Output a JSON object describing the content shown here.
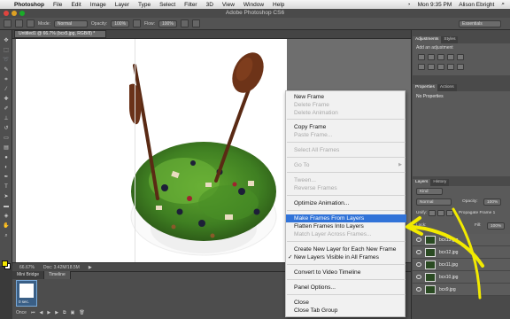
{
  "menubar": {
    "app": "Photoshop",
    "items": [
      "File",
      "Edit",
      "Image",
      "Layer",
      "Type",
      "Select",
      "Filter",
      "3D",
      "View",
      "Window",
      "Help"
    ],
    "clock": "Mon 9:35 PM",
    "user": "Alison Ebright"
  },
  "window": {
    "title": "Adobe Photoshop CS6"
  },
  "options": {
    "mode_label": "Mode:",
    "mode_value": "Normal",
    "opacity_label": "Opacity:",
    "opacity_value": "100%",
    "flow_label": "Flow:",
    "flow_value": "100%",
    "workspace": "Essentials"
  },
  "document": {
    "tab_label": "Untitled1 @ 66.7% (bcx5.jpg, RGB/8) *",
    "zoom": "66.67%",
    "doc_info": "Doc: 3.42M/18.5M"
  },
  "timeline": {
    "tabs": [
      "Mini Bridge",
      "Timeline"
    ],
    "frame_label": "0 sec.",
    "loop": "Once"
  },
  "panels": {
    "adjustments_tabs": [
      "Adjustments",
      "Styles"
    ],
    "adjustments_hint": "Add an adjustment",
    "properties_tabs": [
      "Properties",
      "Actions"
    ],
    "properties_body": "No Properties",
    "layers_tabs": [
      "Layers",
      "History"
    ],
    "kind_filter": "Kind",
    "blend_mode": "Normal",
    "opacity_label": "Opacity:",
    "opacity_value": "100%",
    "unify_label": "Unify:",
    "propagate_label": "Propagate Frame 1",
    "lock_label": "Lock:",
    "fill_label": "Fill:",
    "fill_value": "100%",
    "layers": [
      "bcx13.jpg",
      "bcx12.jpg",
      "bcx11.jpg",
      "bcx10.jpg",
      "bcx9.jpg"
    ]
  },
  "context_menu": {
    "items": [
      {
        "label": "New Frame",
        "enabled": true
      },
      {
        "label": "Delete Frame",
        "enabled": false
      },
      {
        "label": "Delete Animation",
        "enabled": false
      },
      {
        "label": "Copy Frame",
        "enabled": true
      },
      {
        "label": "Paste Frame...",
        "enabled": false
      },
      {
        "label": "Select All Frames",
        "enabled": false
      },
      {
        "label": "Go To",
        "enabled": false
      },
      {
        "label": "Tween...",
        "enabled": false
      },
      {
        "label": "Reverse Frames",
        "enabled": false
      },
      {
        "label": "Optimize Animation...",
        "enabled": true
      },
      {
        "label": "Make Frames From Layers",
        "enabled": true,
        "highlighted": true
      },
      {
        "label": "Flatten Frames Into Layers",
        "enabled": true
      },
      {
        "label": "Match Layer Across Frames...",
        "enabled": false
      },
      {
        "label": "Create New Layer for Each New Frame",
        "enabled": true
      },
      {
        "label": "New Layers Visible in All Frames",
        "enabled": true,
        "checked": true
      },
      {
        "label": "Convert to Video Timeline",
        "enabled": true
      },
      {
        "label": "Panel Options...",
        "enabled": true
      },
      {
        "label": "Close",
        "enabled": true
      },
      {
        "label": "Close Tab Group",
        "enabled": true
      }
    ]
  },
  "colors": {
    "highlight": "#3173d8",
    "annotation": "#f2ea00",
    "foreground_swatch": "#f3e600"
  }
}
